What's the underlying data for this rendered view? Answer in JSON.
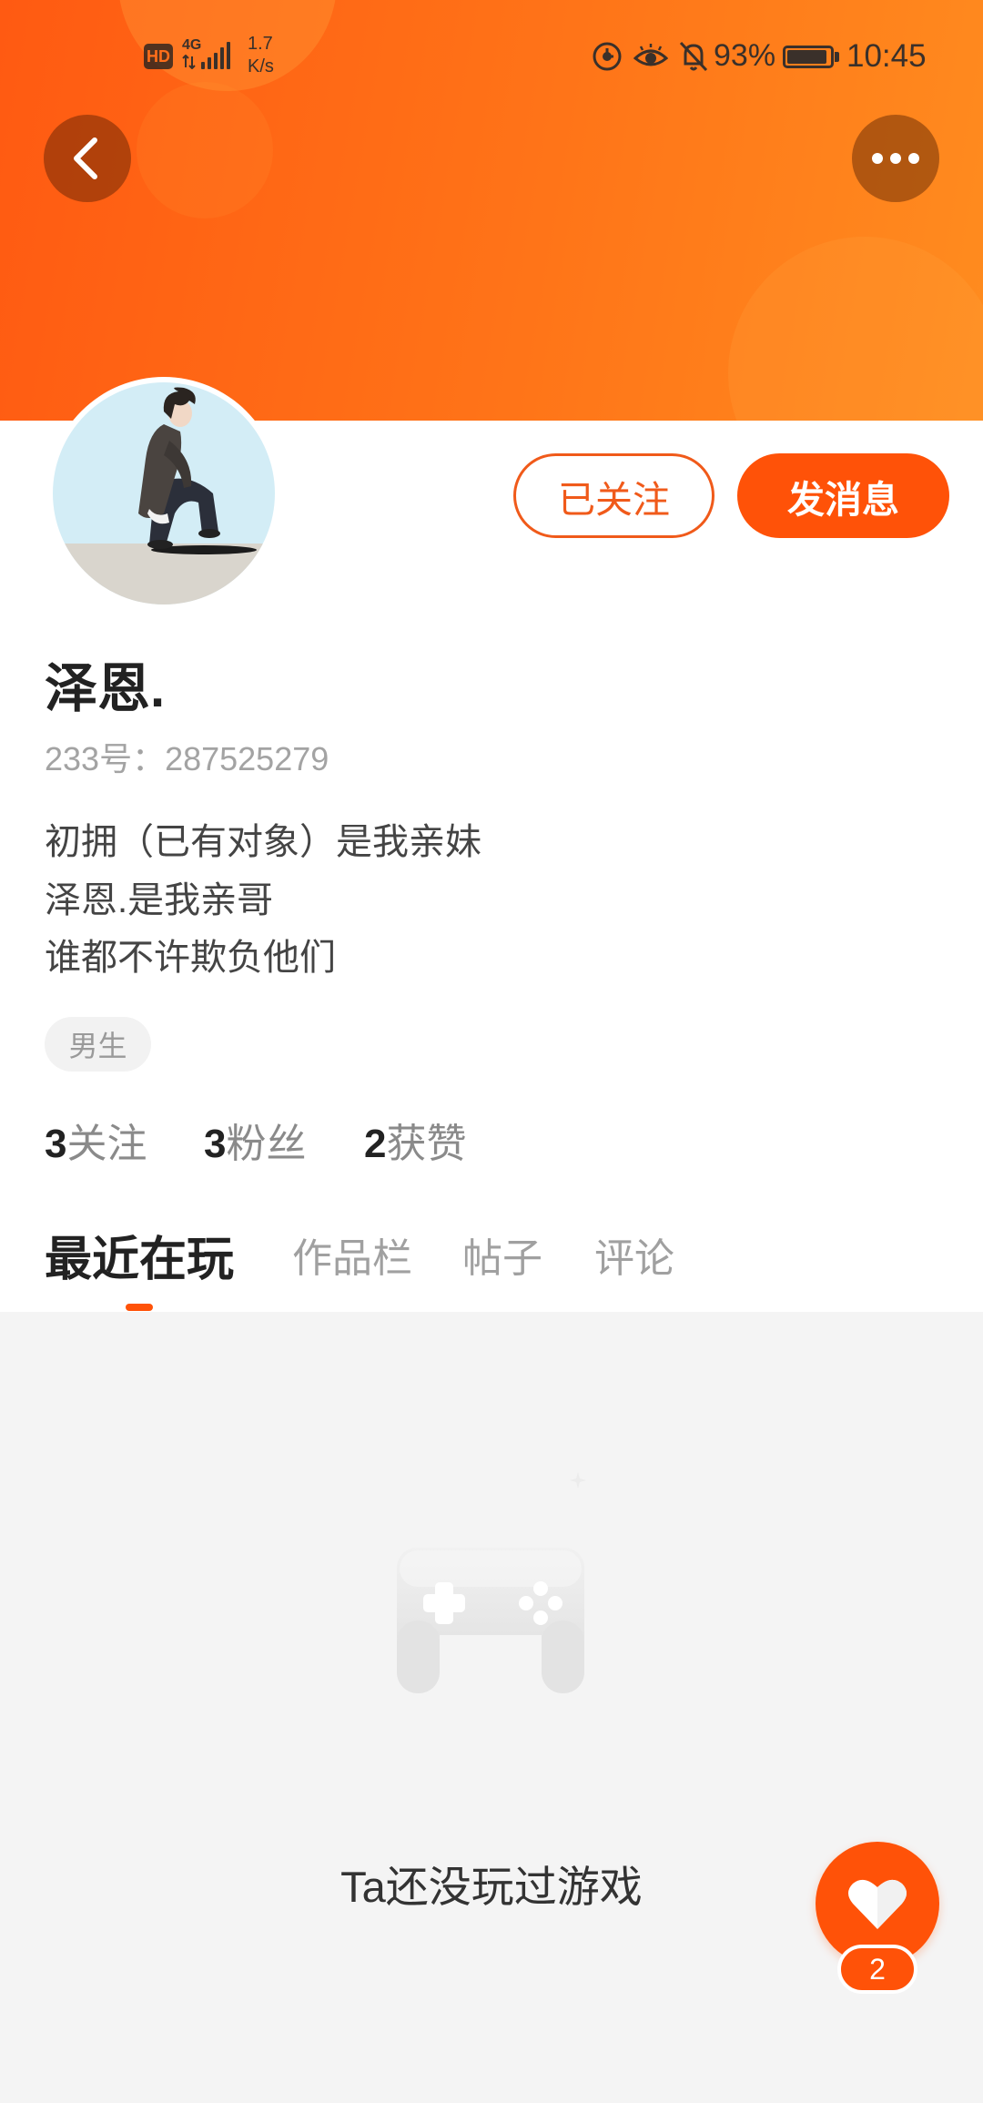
{
  "status_bar": {
    "hd": "HD",
    "network": "4G",
    "speed_value": "1.7",
    "speed_unit": "K/s",
    "icons": [
      "data-saver-icon",
      "eye-comfort-icon",
      "bell-off-icon",
      "battery-icon"
    ],
    "battery_percent": "93%",
    "battery_level": 0.93,
    "time": "10:45"
  },
  "header": {
    "back_icon": "chevron-left-icon",
    "more_icon": "more-horizontal-icon"
  },
  "actions": {
    "followed_label": "已关注",
    "message_label": "发消息"
  },
  "profile": {
    "name": "泽恩.",
    "id_text": "233号：287525279",
    "bio": [
      "初拥（已有对象）是我亲妹",
      "泽恩.是我亲哥",
      "谁都不许欺负他们"
    ],
    "gender_tag": "男生",
    "stats": [
      {
        "count": "3",
        "label": "关注"
      },
      {
        "count": "3",
        "label": "粉丝"
      },
      {
        "count": "2",
        "label": "获赞"
      }
    ]
  },
  "tabs": [
    {
      "label": "最近在玩",
      "active": true
    },
    {
      "label": "作品栏",
      "active": false
    },
    {
      "label": "帖子",
      "active": false
    },
    {
      "label": "评论",
      "active": false
    }
  ],
  "empty_state": {
    "icon": "gamepad-icon",
    "text": "Ta还没玩过游戏"
  },
  "floating_like": {
    "icon": "heart-icon",
    "count": "2"
  },
  "colors": {
    "accent": "#FF5208",
    "header_start": "#FF5A12",
    "header_end": "#FF8C1F",
    "page_bg": "#F4F4F4"
  }
}
